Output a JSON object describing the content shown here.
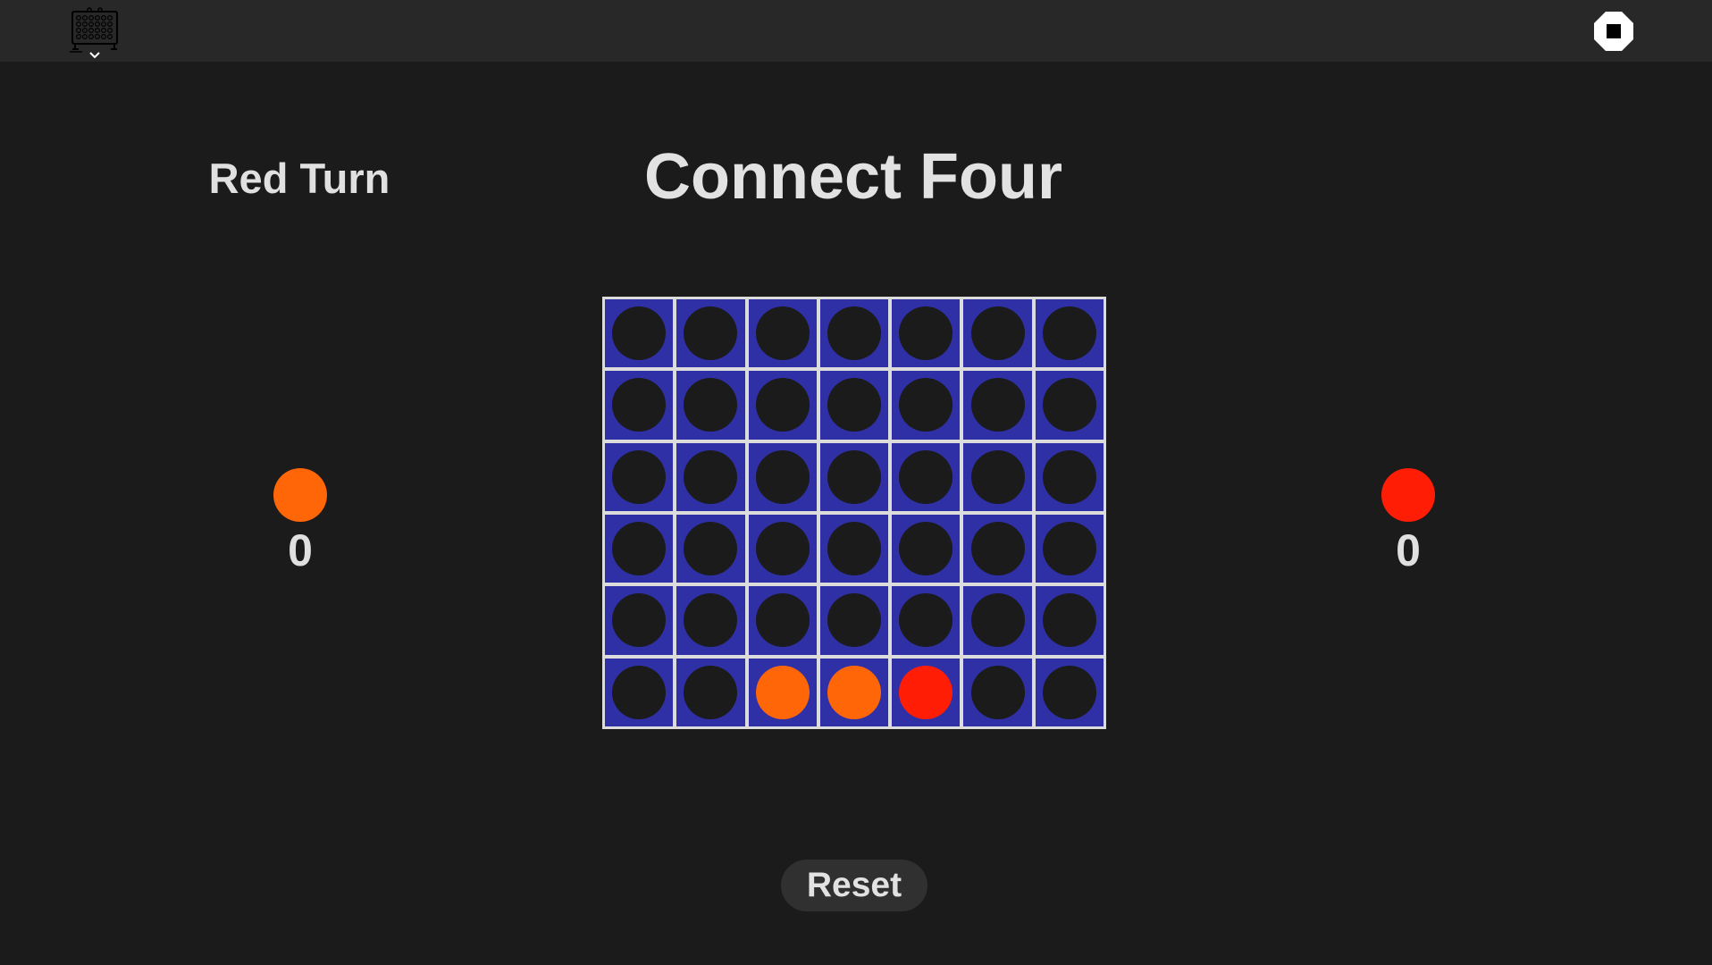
{
  "game": {
    "title": "Connect Four",
    "turn_label": "Red Turn",
    "reset_label": "Reset",
    "rows": 6,
    "cols": 7,
    "board": [
      [
        "empty",
        "empty",
        "empty",
        "empty",
        "empty",
        "empty",
        "empty"
      ],
      [
        "empty",
        "empty",
        "empty",
        "empty",
        "empty",
        "empty",
        "empty"
      ],
      [
        "empty",
        "empty",
        "empty",
        "empty",
        "empty",
        "empty",
        "empty"
      ],
      [
        "empty",
        "empty",
        "empty",
        "empty",
        "empty",
        "empty",
        "empty"
      ],
      [
        "empty",
        "empty",
        "empty",
        "empty",
        "empty",
        "empty",
        "empty"
      ],
      [
        "empty",
        "empty",
        "orange",
        "orange",
        "red",
        "empty",
        "empty"
      ]
    ]
  },
  "players": {
    "orange": {
      "score": "0",
      "color": "#ff6608"
    },
    "red": {
      "score": "0",
      "color": "#ff1d06"
    }
  },
  "colors": {
    "background": "#1b1b1b",
    "topbar": "#282828",
    "board_frame": "#dcdcdc",
    "cell": "#2f2fa6",
    "empty_slot": "#1b1b1b",
    "orange": "#ff6608",
    "red": "#ff1d06"
  },
  "icons": {
    "app": "connect-four-board-icon",
    "dropdown": "chevron-down-icon",
    "stop": "stop-icon"
  }
}
